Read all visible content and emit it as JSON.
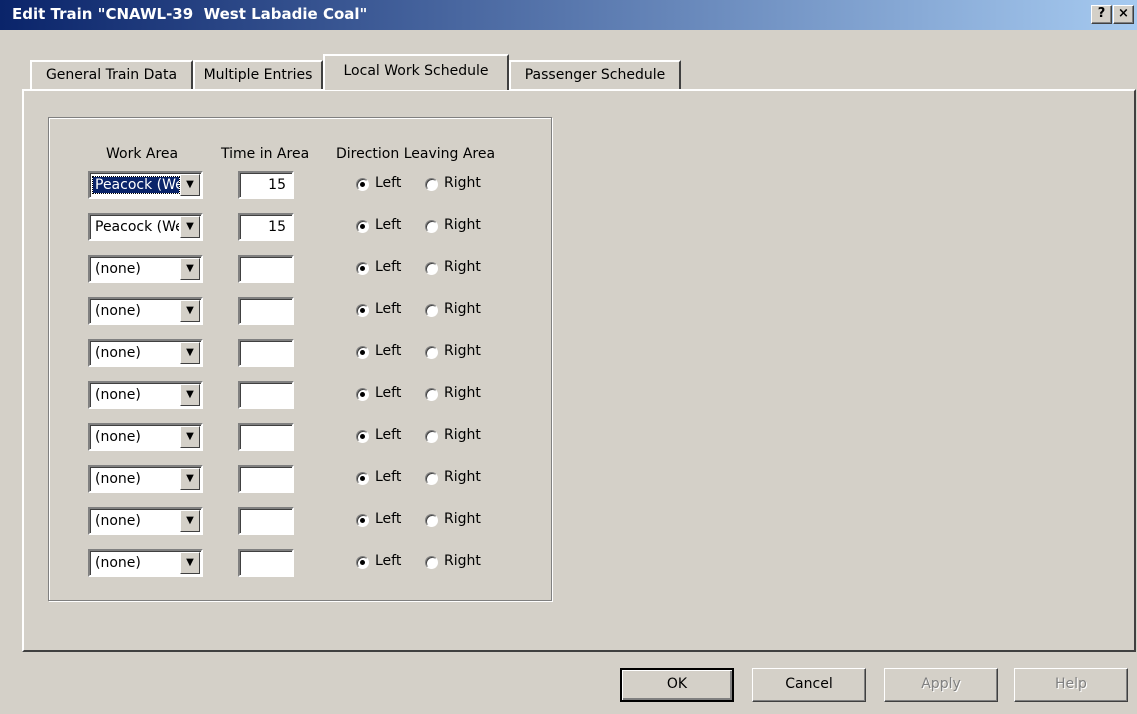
{
  "window": {
    "title": "Edit Train \"CNAWL-39  West Labadie Coal\"",
    "help_btn": "?",
    "close_btn": "×"
  },
  "tabs": [
    {
      "label": "General Train Data",
      "active": false
    },
    {
      "label": "Multiple Entries",
      "active": false
    },
    {
      "label": "Local Work Schedule",
      "active": true
    },
    {
      "label": "Passenger Schedule",
      "active": false
    }
  ],
  "headers": {
    "work_area": "Work Area",
    "time_in_area": "Time in Area",
    "direction": "Direction Leaving Area"
  },
  "labels": {
    "left": "Left",
    "right": "Right"
  },
  "rows": [
    {
      "work_area": "Peacock (West)",
      "time": "15",
      "direction": "Left",
      "selected": true
    },
    {
      "work_area": "Peacock (West)",
      "time": "15",
      "direction": "Left",
      "selected": false
    },
    {
      "work_area": "(none)",
      "time": "",
      "direction": "Left",
      "selected": false
    },
    {
      "work_area": "(none)",
      "time": "",
      "direction": "Left",
      "selected": false
    },
    {
      "work_area": "(none)",
      "time": "",
      "direction": "Left",
      "selected": false
    },
    {
      "work_area": "(none)",
      "time": "",
      "direction": "Left",
      "selected": false
    },
    {
      "work_area": "(none)",
      "time": "",
      "direction": "Left",
      "selected": false
    },
    {
      "work_area": "(none)",
      "time": "",
      "direction": "Left",
      "selected": false
    },
    {
      "work_area": "(none)",
      "time": "",
      "direction": "Left",
      "selected": false
    },
    {
      "work_area": "(none)",
      "time": "",
      "direction": "Left",
      "selected": false
    }
  ],
  "buttons": {
    "ok": "OK",
    "cancel": "Cancel",
    "apply": "Apply",
    "help": "Help"
  }
}
